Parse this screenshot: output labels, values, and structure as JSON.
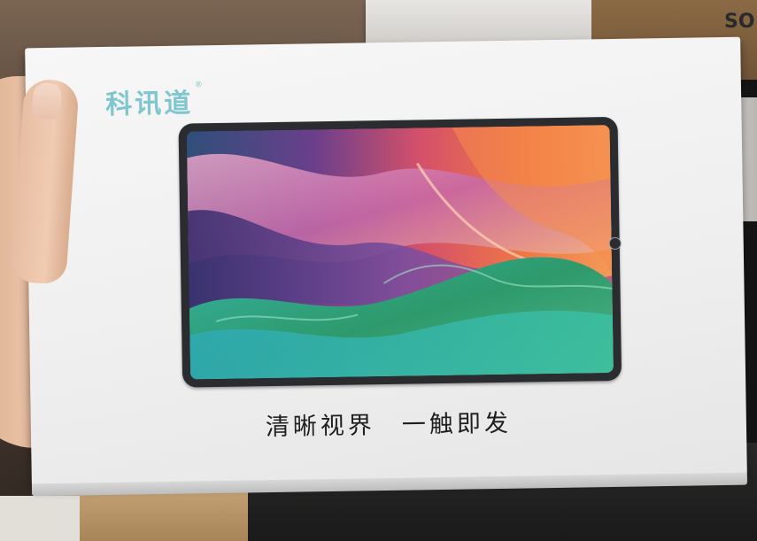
{
  "box": {
    "brand_name": "科讯道",
    "brand_mark": "®",
    "tagline_part1": "清晰视界",
    "tagline_part2": "一触即发"
  },
  "background": {
    "carton_text": "SO"
  },
  "colors": {
    "brand_teal": "#7fc6cf",
    "box_white": "#f4f4f4",
    "tablet_bezel": "#2a2c30",
    "text_dark": "#1f1f1f"
  },
  "icons": {
    "home_button": "home-button-icon"
  }
}
